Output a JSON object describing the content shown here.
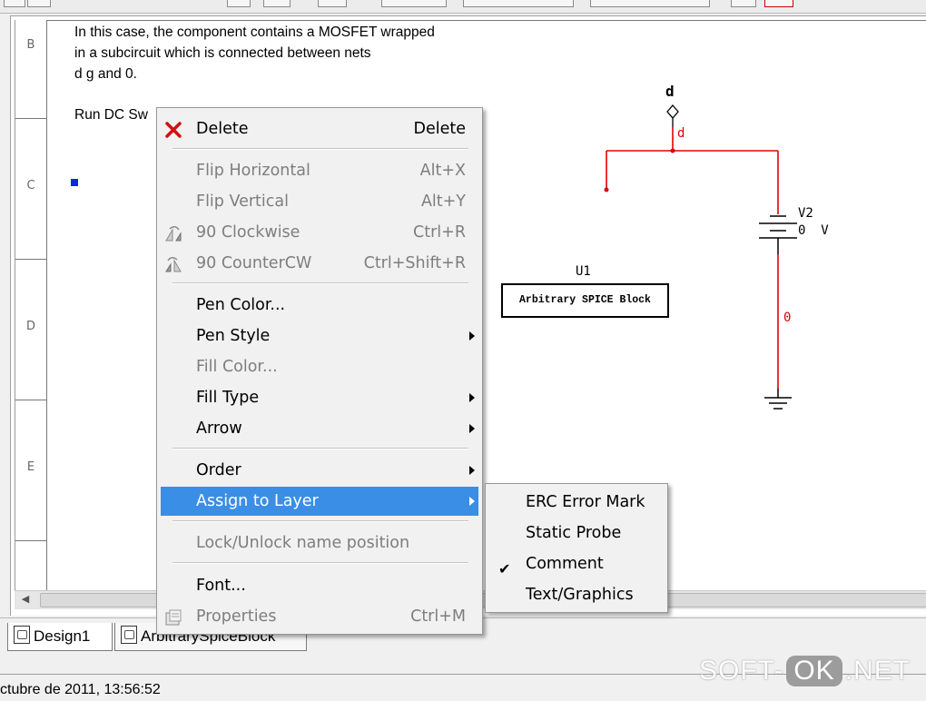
{
  "note": {
    "lines": [
      "In this case, the component contains a MOSFET wrapped",
      "in a subcircuit which is connected between nets",
      "d g and 0.",
      "Run DC Sw"
    ]
  },
  "ruler": {
    "labels": [
      "B",
      "C",
      "D",
      "E"
    ]
  },
  "schematic": {
    "net_label_top": "d",
    "net_label_d": "d",
    "net_label_zero": "0",
    "source_name": "V2",
    "source_value": "0  V",
    "component_name": "U1",
    "component_text": "Arbitrary SPICE Block"
  },
  "context_menu": {
    "delete": {
      "label": "Delete",
      "shortcut": "Delete",
      "icon": "red-x-icon"
    },
    "flip_horizontal": {
      "label": "Flip Horizontal",
      "shortcut": "Alt+X"
    },
    "flip_vertical": {
      "label": "Flip Vertical",
      "shortcut": "Alt+Y"
    },
    "rotate_cw": {
      "label": "90 Clockwise",
      "shortcut": "Ctrl+R",
      "icon": "rotate-cw-icon"
    },
    "rotate_ccw": {
      "label": "90 CounterCW",
      "shortcut": "Ctrl+Shift+R",
      "icon": "rotate-ccw-icon"
    },
    "pen_color": {
      "label": "Pen Color..."
    },
    "pen_style": {
      "label": "Pen Style"
    },
    "fill_color": {
      "label": "Fill Color..."
    },
    "fill_type": {
      "label": "Fill Type"
    },
    "arrow": {
      "label": "Arrow"
    },
    "order": {
      "label": "Order"
    },
    "assign_to_layer": {
      "label": "Assign to Layer"
    },
    "lock_unlock": {
      "label": "Lock/Unlock name position"
    },
    "font": {
      "label": "Font..."
    },
    "properties": {
      "label": "Properties",
      "shortcut": "Ctrl+M",
      "icon": "properties-icon"
    }
  },
  "layer_submenu": {
    "items": [
      {
        "label": "ERC Error Mark",
        "checked": false
      },
      {
        "label": "Static Probe",
        "checked": false
      },
      {
        "label": "Comment",
        "checked": true
      },
      {
        "label": "Text/Graphics",
        "checked": false
      }
    ]
  },
  "tabs": [
    {
      "label": "Design1",
      "active": true
    },
    {
      "label": "ArbitrarySpiceBlock",
      "active": false
    }
  ],
  "status": {
    "text": "ctubre de 2011, 13:56:52"
  },
  "watermark": {
    "part1": "SOFT-",
    "part2": "OK",
    "part3": ".NET"
  },
  "colors": {
    "wire_red": "#e00000",
    "highlight": "#3a8ee6",
    "selection_marker": "#0a2cd8"
  }
}
